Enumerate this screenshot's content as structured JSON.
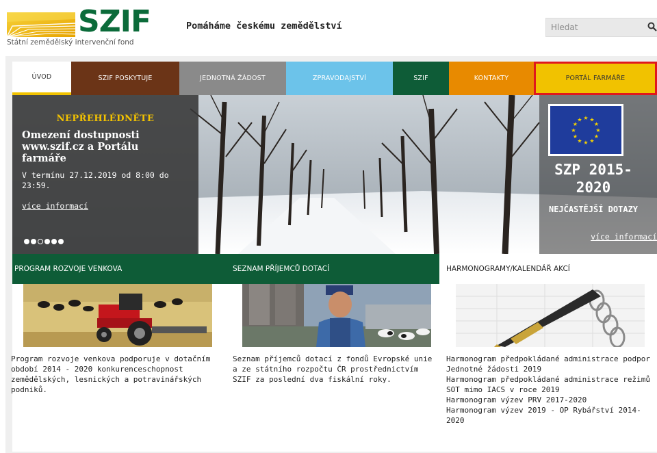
{
  "header": {
    "logo_text": "SZIF",
    "logo_subtitle": "Státní zemědělský intervenční fond",
    "tagline": "Pomáháme českému zemědělství",
    "search_placeholder": "Hledat",
    "search_icon": "magnifier-icon"
  },
  "nav": {
    "items": [
      {
        "label": "ÚVOD"
      },
      {
        "label": "SZIF POSKYTUJE"
      },
      {
        "label": "JEDNOTNÁ ŽÁDOST"
      },
      {
        "label": "ZPRAVODAJSTVÍ"
      },
      {
        "label": "SZIF"
      },
      {
        "label": "KONTAKTY"
      },
      {
        "label": "PORTÁL FARMÁŘE"
      }
    ]
  },
  "hero": {
    "kicker": "NEPŘEHLÉDNĚTE",
    "title": "Omezení dostupnosti www.szif.cz a Portálu farmáře",
    "text": "V termínu 27.12.2019 od 8:00 do 23:59.",
    "link": "více informací",
    "slides_total": 6,
    "slide_active": 3
  },
  "szp": {
    "title": "SZP 2015-2020",
    "subtitle": "NEJČASTĚJŠÍ DOTAZY",
    "link": "více informací"
  },
  "columns": [
    {
      "heading": "PROGRAM ROZVOJE VENKOVA",
      "text": "Program rozvoje venkova podporuje v dotačním období 2014 - 2020 konkurenceschopnost zemědělských, lesnických a potravinářských podniků."
    },
    {
      "heading": "SEZNAM PŘÍJEMCŮ DOTACÍ",
      "text": "Seznam příjemců dotací z fondů Evropské unie a ze státního rozpočtu ČR prostřednictvím SZIF za poslední dva fiskální roky."
    },
    {
      "heading": "HARMONOGRAMY/KALENDÁŘ AKCÍ",
      "links": [
        "Harmonogram předpokládané administrace podpor Jednotné žádosti 2019",
        "Harmonogram předpokládané administrace režimů SOT mimo IACS v roce 2019",
        "Harmonogram výzev PRV 2017-2020",
        "Harmonogram výzev 2019 - OP Rybářství 2014-2020"
      ]
    }
  ],
  "colors": {
    "brand_green": "#0e5c37",
    "brand_yellow": "#f1c200",
    "nav_brown": "#6b3417",
    "nav_gray": "#8a8a8a",
    "nav_blue": "#6cc3ea",
    "nav_orange": "#e88a00",
    "highlight_red": "#e0181c"
  }
}
